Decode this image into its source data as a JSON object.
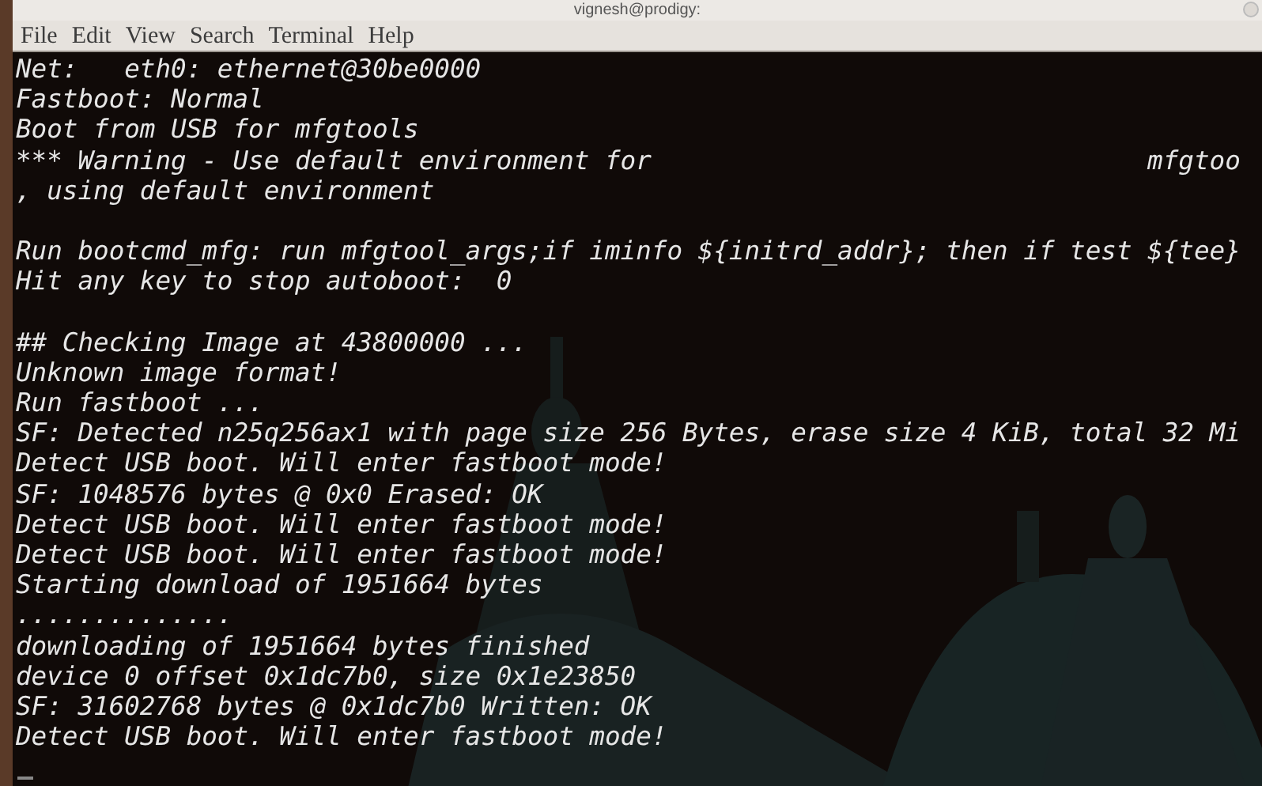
{
  "window": {
    "title": "vignesh@prodigy:"
  },
  "menu": [
    "File",
    "Edit",
    "View",
    "Search",
    "Terminal",
    "Help"
  ],
  "terminal": {
    "lines": [
      "Net:   eth0: ethernet@30be0000",
      "Fastboot: Normal",
      "Boot from USB for mfgtools",
      "*** Warning - Use default environment for                                mfgtoo",
      ", using default environment",
      {
        "text": "Run bootcmd_mfg: run mfgtool_args;if iminfo ${initrd_addr}; then if test ${tee}",
        "blank_line_before": true
      },
      "Hit any key to stop autoboot:  0",
      {
        "text": "## Checking Image at 43800000 ...",
        "blank_line_before": true
      },
      "Unknown image format!",
      "Run fastboot ...",
      "SF: Detected n25q256ax1 with page size 256 Bytes, erase size 4 KiB, total 32 Mi",
      "Detect USB boot. Will enter fastboot mode!",
      "SF: 1048576 bytes @ 0x0 Erased: OK",
      "Detect USB boot. Will enter fastboot mode!",
      "Detect USB boot. Will enter fastboot mode!",
      "Starting download of 1951664 bytes",
      "..............",
      "downloading of 1951664 bytes finished",
      "device 0 offset 0x1dc7b0, size 0x1e23850",
      "SF: 31602768 bytes @ 0x1dc7b0 Written: OK",
      "Detect USB boot. Will enter fastboot mode!"
    ]
  }
}
